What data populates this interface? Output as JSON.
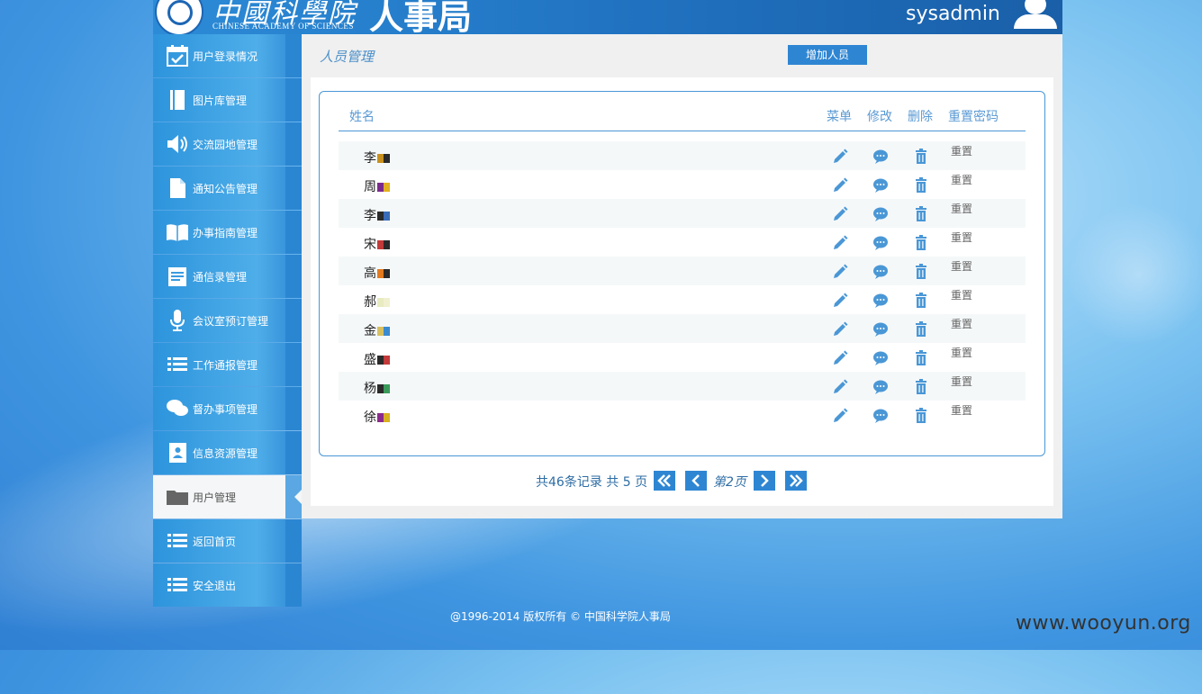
{
  "header": {
    "logo_cn": "中國科學院",
    "logo_en": "CHINESE ACADEMY OF SCIENCES",
    "dept": "人事局",
    "username": "sysadmin"
  },
  "sidebar": {
    "items": [
      {
        "label": "用户登录情况",
        "icon": "calendar-check-icon"
      },
      {
        "label": "图片库管理",
        "icon": "book-icon"
      },
      {
        "label": "交流园地管理",
        "icon": "speaker-icon"
      },
      {
        "label": "通知公告管理",
        "icon": "document-icon"
      },
      {
        "label": "办事指南管理",
        "icon": "open-book-icon"
      },
      {
        "label": "通信录管理",
        "icon": "clipboard-icon"
      },
      {
        "label": "会议室预订管理",
        "icon": "microphone-icon"
      },
      {
        "label": "工作通报管理",
        "icon": "list-icon"
      },
      {
        "label": "督办事项管理",
        "icon": "chat-bubbles-icon"
      },
      {
        "label": "信息资源管理",
        "icon": "contact-card-icon"
      },
      {
        "label": "用户管理",
        "icon": "folder-icon",
        "active": true
      },
      {
        "label": "返回首页",
        "icon": "list-icon"
      },
      {
        "label": "安全退出",
        "icon": "list-icon"
      }
    ]
  },
  "main": {
    "title": "人员管理",
    "add_button": "增加人员",
    "columns": {
      "name": "姓名",
      "menu": "菜单",
      "edit": "修改",
      "delete": "删除",
      "reset": "重置密码"
    },
    "rows": [
      {
        "name": "李",
        "reset": "重置"
      },
      {
        "name": "周",
        "reset": "重置"
      },
      {
        "name": "李",
        "reset": "重置"
      },
      {
        "name": "宋",
        "reset": "重置"
      },
      {
        "name": "高",
        "reset": "重置"
      },
      {
        "name": "郝",
        "reset": "重置"
      },
      {
        "name": "金",
        "reset": "重置"
      },
      {
        "name": "盛",
        "reset": "重置"
      },
      {
        "name": "杨",
        "reset": "重置"
      },
      {
        "name": "徐",
        "reset": "重置"
      }
    ],
    "pager": {
      "info": "共46条记录 共 5 页",
      "current": "第2页"
    }
  },
  "footer": "@1996-2014 版权所有 © 中国科学院人事局",
  "watermark": "www.wooyun.org",
  "colors": {
    "accent": "#2e86d3",
    "header": "#1f6fbd",
    "text_link": "#4a8fc9"
  }
}
